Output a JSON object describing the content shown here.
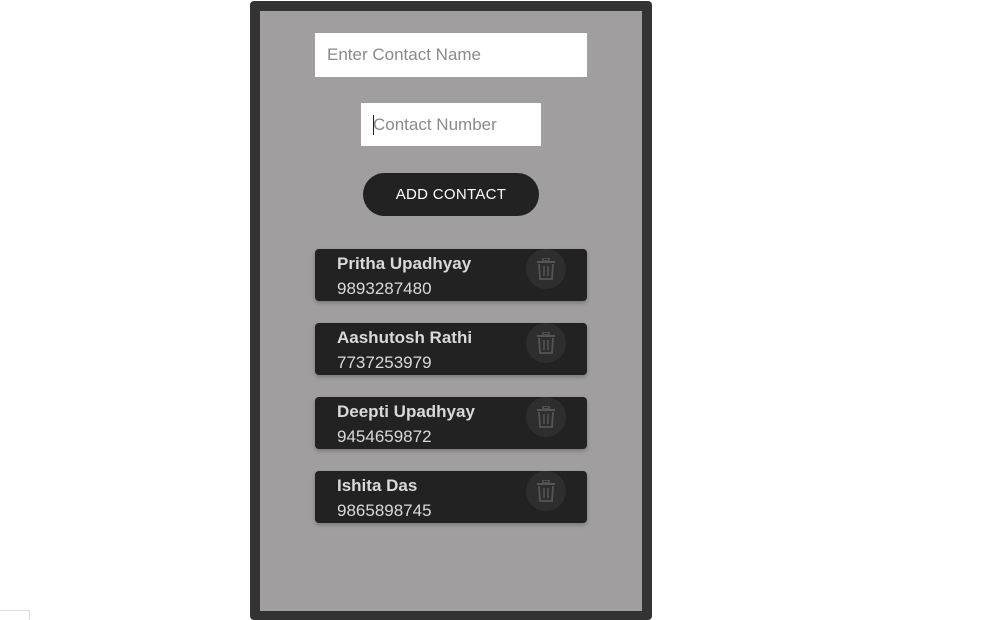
{
  "form": {
    "name_placeholder": "Enter Contact Name",
    "number_placeholder": "Contact Number",
    "add_button_label": "ADD CONTACT"
  },
  "contacts": [
    {
      "name": "Pritha Upadhyay",
      "number": "9893287480"
    },
    {
      "name": "Aashutosh Rathi",
      "number": "7737253979"
    },
    {
      "name": "Deepti Upadhyay",
      "number": "9454659872"
    },
    {
      "name": "Ishita Das",
      "number": "9865898745"
    }
  ],
  "icons": {
    "delete": "trash-icon"
  },
  "colors": {
    "frame": "#333333",
    "panel": "#a09e9f",
    "card": "#222222",
    "button": "#222222",
    "text_light": "#d9d9d9"
  }
}
